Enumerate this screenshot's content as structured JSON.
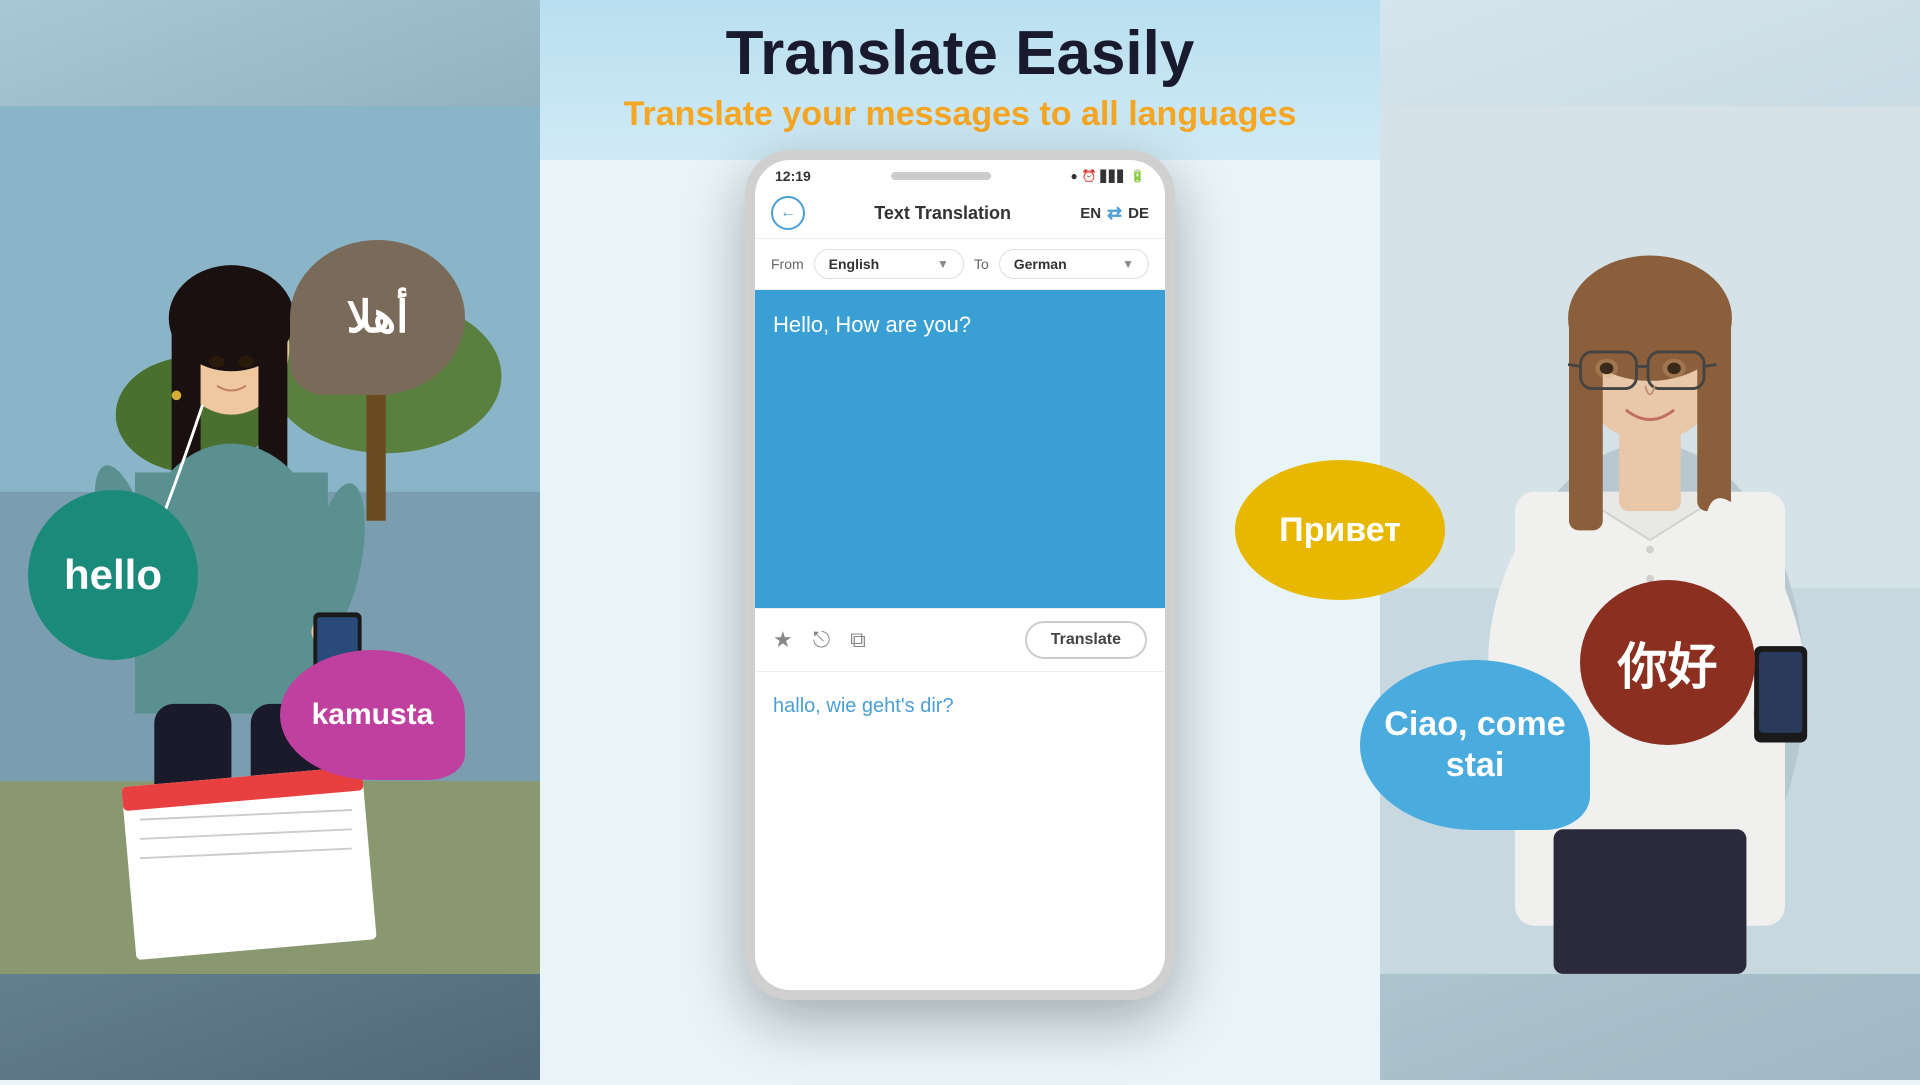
{
  "page": {
    "main_title": "Translate Easily",
    "sub_title": "Translate your messages to all languages"
  },
  "status_bar": {
    "time": "12:19",
    "icons": "● ☎ ᯤ.ıll 🔋"
  },
  "app_header": {
    "title": "Text Translation",
    "lang_from": "EN",
    "lang_to": "DE",
    "back_icon": "←",
    "swap_icon": "⇄"
  },
  "lang_row": {
    "from_label": "From",
    "from_value": "English",
    "to_label": "To",
    "to_value": "German",
    "dropdown_arrow": "▼"
  },
  "input_area": {
    "text": "Hello, How are you?"
  },
  "action_bar": {
    "star_icon": "★",
    "share_icon": "⎋",
    "copy_icon": "⧉",
    "translate_btn": "Translate"
  },
  "output_area": {
    "text": "hallo, wie geht's dir?"
  },
  "bubbles": {
    "hello": "hello",
    "arabic": "أهلا",
    "kamusta": "kamusta",
    "privet": "Привет",
    "chinese": "你好",
    "ciao_line1": "Ciao, come",
    "ciao_line2": "stai"
  }
}
